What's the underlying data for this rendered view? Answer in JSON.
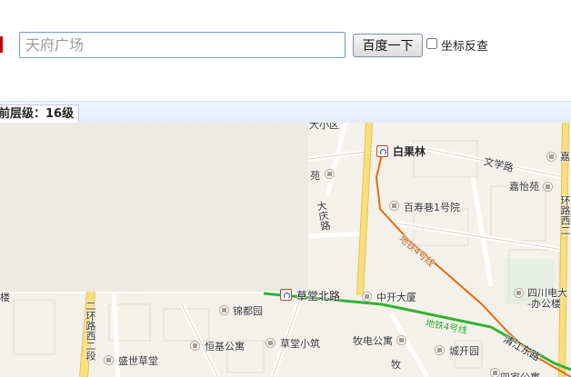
{
  "search": {
    "placeholder": "天府广场",
    "button_label": "百度一下",
    "checkbox_label": "坐标反查",
    "checkbox_checked": false
  },
  "map": {
    "zoom_label": "前层级：16级",
    "labels": {
      "top_fragment": "大小区",
      "baiguolin": "白果林",
      "wenxue_road": "文学路",
      "jiayi_yuan": "嘉怡苑",
      "jia": "嘉",
      "yuan": "苑",
      "daqing_road": "大庆路",
      "baishou_alley": "百寿巷1号院",
      "second_ring_west_right": "环路西二",
      "metro4_north": "地铁4号线",
      "caotang_north_road": "草堂北路",
      "zhongkai": "中开大厦",
      "sichuan_power": "四川电大",
      "office_building": "-办公楼",
      "lou": "楼",
      "jindu_garden": "锦都园",
      "metro4_south": "地铁4号线",
      "second_ring_west_left": "二环路西二段",
      "hengji": "恒基公寓",
      "caotang_xiaozhu": "草堂小筑",
      "mudian": "牧电公寓",
      "chengkai": "城开园",
      "qingjiang_east": "清江东路",
      "shengshi": "盛世草堂",
      "mu": "牧",
      "bottom_fragment": "四家公寓"
    }
  },
  "colors": {
    "accent_red": "#c00000",
    "metro_line4": "#e46c0a",
    "metro_green": "#33b233",
    "road_yellow": "#f6d66a",
    "bar_blue": "#e3ebfb"
  }
}
